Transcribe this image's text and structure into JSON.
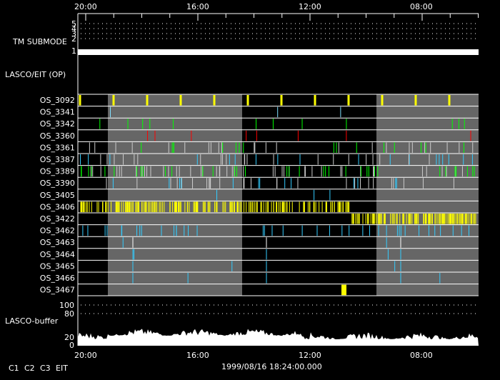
{
  "time_ticks": [
    "20:00",
    "16:00",
    "12:00",
    "08:00"
  ],
  "tm_submode": {
    "label": "TM SUBMODE",
    "levels": [
      "5",
      "4",
      "3",
      "2",
      "1"
    ]
  },
  "op_label": "LASCO/EIT (OP)",
  "rows": [
    {
      "name": "OS_3092",
      "color": "#ffff00"
    },
    {
      "name": "OS_3341",
      "color": "#7fdfff"
    },
    {
      "name": "OS_3342",
      "color": "#00ff00"
    },
    {
      "name": "OS_3360",
      "color": "#ff0000"
    },
    {
      "name": "OS_3361",
      "color": "#00ff00"
    },
    {
      "name": "OS_3387",
      "color": "#33ccff"
    },
    {
      "name": "OS_3389",
      "color": "#00ff00"
    },
    {
      "name": "OS_3390",
      "color": "#33ccff"
    },
    {
      "name": "OS_3405",
      "color": "#33ccff"
    },
    {
      "name": "OS_3406",
      "color": "#ffff00"
    },
    {
      "name": "OS_3422",
      "color": "#ffff00"
    },
    {
      "name": "OS_3462",
      "color": "#33ccff"
    },
    {
      "name": "OS_3463",
      "color": "#33ccff"
    },
    {
      "name": "OS_3464",
      "color": "#33ccff"
    },
    {
      "name": "OS_3465",
      "color": "#33ccff"
    },
    {
      "name": "OS_3466",
      "color": "#33ccff"
    },
    {
      "name": "OS_3467",
      "color": "#ffff00"
    }
  ],
  "buffer": {
    "label": "LASCO-buffer",
    "ticks": [
      "100",
      "80",
      "20",
      "0"
    ]
  },
  "timestamp": "1999/08/16 18:24:00.000",
  "legend": [
    {
      "label": "C1",
      "color": "#ff0000"
    },
    {
      "label": "C2",
      "color": "#00ff00"
    },
    {
      "label": "C3",
      "color": "#aaddff"
    },
    {
      "label": "EIT",
      "color": "#ffff00"
    }
  ]
}
